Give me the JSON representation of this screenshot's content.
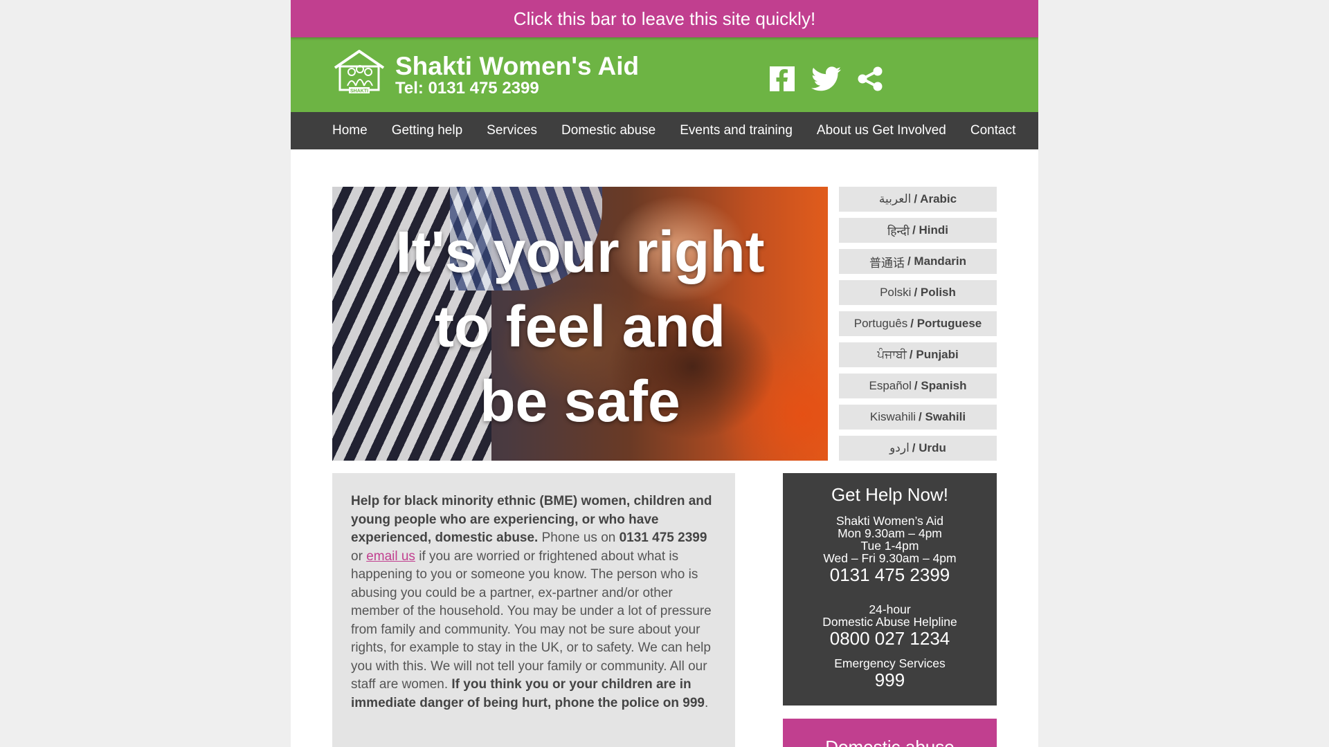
{
  "quick_exit": {
    "label": "Click this bar to leave this site quickly!"
  },
  "header": {
    "title": "Shakti Women's Aid",
    "tel": "Tel: 0131 475 2399",
    "logo_text": "SHAKTI",
    "social": [
      "facebook-icon",
      "twitter-icon",
      "share-icon"
    ]
  },
  "nav": {
    "items": [
      {
        "label": "Home"
      },
      {
        "label": "Getting help"
      },
      {
        "label": "Services"
      },
      {
        "label": "Domestic abuse"
      },
      {
        "label": "Events and training"
      },
      {
        "label": "About us Get Involved"
      },
      {
        "label": "Contact"
      }
    ]
  },
  "hero": {
    "line1": "It's your right",
    "line2": "to feel and",
    "line3": "be safe"
  },
  "languages": [
    {
      "native": "العربية",
      "english": "/ Arabic"
    },
    {
      "native": "हिन्दी",
      "english": "/ Hindi"
    },
    {
      "native": "普通话",
      "english": "/ Mandarin"
    },
    {
      "native": "Polski",
      "english": "/ Polish"
    },
    {
      "native": "Português",
      "english": "/ Portuguese"
    },
    {
      "native": "ਪੰਜਾਬੀ",
      "english": "/ Punjabi"
    },
    {
      "native": "Español",
      "english": "/ Spanish"
    },
    {
      "native": "Kiswahili",
      "english": "/ Swahili"
    },
    {
      "native": "اردو",
      "english": "/ Urdu"
    }
  ],
  "intro": {
    "bold_lead": "Help for black minority ethnic (BME) women, children and young people who are experiencing, or who have experienced, domestic abuse.",
    "phone_prefix": " Phone us on ",
    "phone": "0131 475 2399",
    "or_text": " or ",
    "email_link": "email us",
    "body": " if you are worried or frightened about what is happening to you or someone you know. The person who is abusing you could be a partner, ex-partner and/or other member of the household.  You may be under a lot of pressure from family and community. You may not be sure about your rights, for example to stay in the UK, or to safety. We can help you with this.  We will not tell your family or community. All our staff are women. ",
    "bold_warning": "If you think you or your children are in immediate danger of being hurt, phone the police on 999",
    "end": "."
  },
  "help_box": {
    "title": "Get Help Now!",
    "org": "Shakti Women’s Aid",
    "hours_mon": "Mon 9.30am – 4pm",
    "hours_tue": "Tue 1-4pm",
    "hours_wed_fri": "Wed – Fri 9.30am – 4pm",
    "phone": "0131 475 2399",
    "helpline_line1": "24-hour",
    "helpline_line2": "Domestic Abuse Helpline",
    "helpline_phone": "0800 027 1234",
    "emergency_label": "Emergency Services",
    "emergency_number": "999"
  },
  "dv_box": {
    "title": "Domestic abuse"
  },
  "colors": {
    "brand_green": "#6db444",
    "brand_magenta": "#c13f8f",
    "nav_dark": "#3f3f3f",
    "panel_grey": "#e4e4e4"
  }
}
